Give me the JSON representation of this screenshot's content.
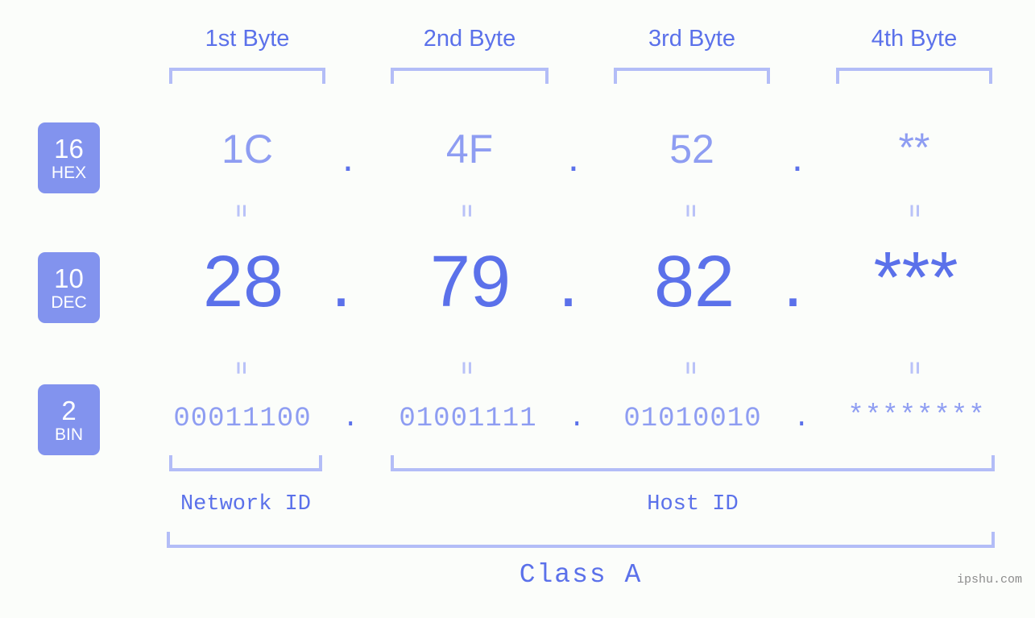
{
  "colors": {
    "background": "#fbfdfa",
    "accent_strong": "#5b71ea",
    "accent_mid": "#8e9df2",
    "accent_light": "#b3bdf7",
    "badge_fill": "#8293ee",
    "badge_text": "#ffffff",
    "watermark": "#8c8c8c"
  },
  "byte_headers": [
    {
      "label": "1st Byte"
    },
    {
      "label": "2nd Byte"
    },
    {
      "label": "3rd Byte"
    },
    {
      "label": "4th Byte"
    }
  ],
  "bases": [
    {
      "number": "16",
      "name": "HEX"
    },
    {
      "number": "10",
      "name": "DEC"
    },
    {
      "number": "2",
      "name": "BIN"
    }
  ],
  "rows": {
    "hex": {
      "base_number": "16",
      "base_name": "HEX",
      "values": [
        "1C",
        "4F",
        "52",
        "**"
      ],
      "separator": "."
    },
    "dec": {
      "base_number": "10",
      "base_name": "DEC",
      "values": [
        "28",
        "79",
        "82",
        "***"
      ],
      "separator": "."
    },
    "bin": {
      "base_number": "2",
      "base_name": "BIN",
      "values": [
        "00011100",
        "01001111",
        "01010010",
        "********"
      ],
      "separator": "."
    }
  },
  "equals_glyph": "=",
  "id_sections": [
    {
      "label": "Network ID"
    },
    {
      "label": "Host ID"
    }
  ],
  "class_label": "Class A",
  "watermark": "ipshu.com"
}
